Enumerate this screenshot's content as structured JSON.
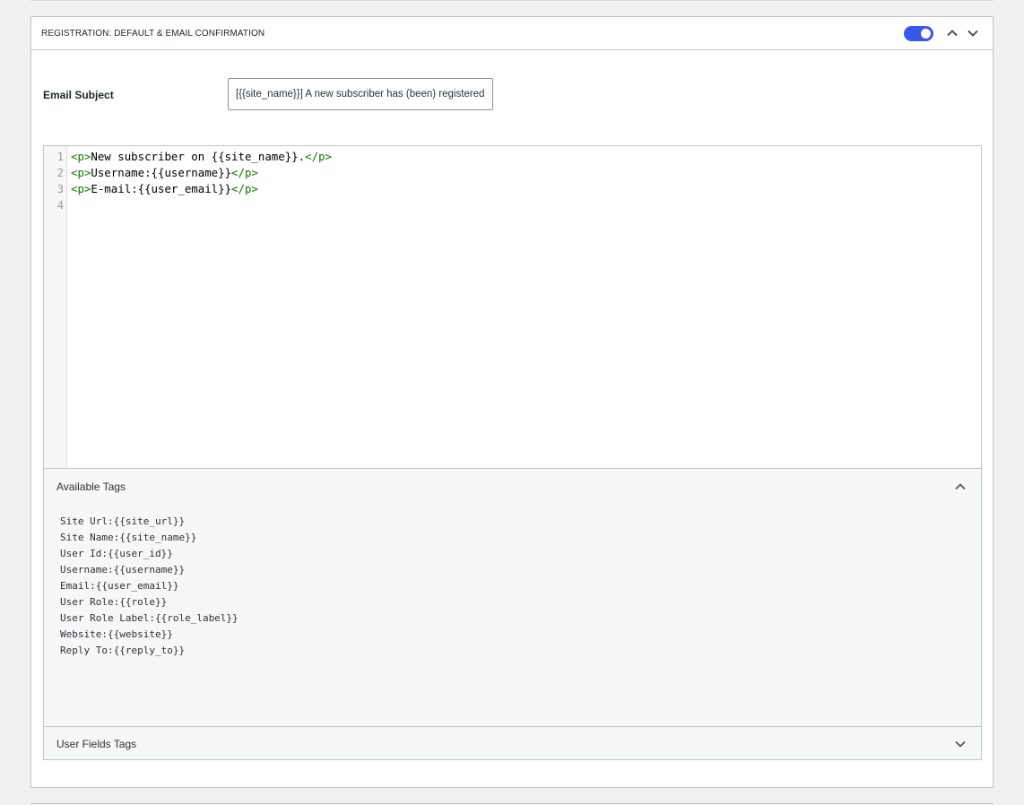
{
  "panel": {
    "title": "REGISTRATION: DEFAULT & EMAIL CONFIRMATION",
    "toggle_on": true,
    "accent_color": "#3858e9"
  },
  "subject": {
    "label": "Email Subject",
    "value": "[{{site_name}}] A new subscriber has (been) registered!"
  },
  "editor": {
    "line_numbers": [
      "1",
      "2",
      "3",
      "4"
    ],
    "lines": [
      {
        "open": "<p>",
        "text": "New subscriber on {{site_name}}.",
        "close": "</p>"
      },
      {
        "open": "<p>",
        "text": "Username:{{username}}",
        "close": "</p>"
      },
      {
        "open": "<p>",
        "text": "E-mail:{{user_email}}",
        "close": "</p>"
      }
    ]
  },
  "available_tags": {
    "title": "Available Tags",
    "items": [
      "Site Url:{{site_url}}",
      "Site Name:{{site_name}}",
      "User Id:{{user_id}}",
      "Username:{{username}}",
      "Email:{{user_email}}",
      "User Role:{{role}}",
      "User Role Label:{{role_label}}",
      "Website:{{website}}",
      "Reply To:{{reply_to}}"
    ]
  },
  "user_fields_tags": {
    "title": "User Fields Tags"
  }
}
